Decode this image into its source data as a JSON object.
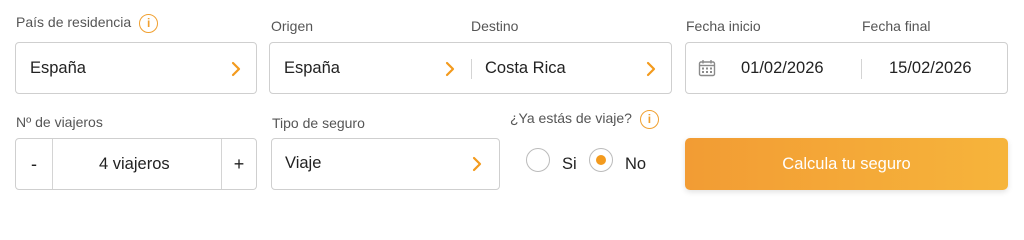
{
  "residence": {
    "label": "País de residencia",
    "value": "España"
  },
  "route": {
    "origin_label": "Origen",
    "origin_value": "España",
    "destination_label": "Destino",
    "destination_value": "Costa Rica"
  },
  "dates": {
    "start_label": "Fecha inicio",
    "start_value": "01/02/2026",
    "end_label": "Fecha final",
    "end_value": "15/02/2026"
  },
  "travelers": {
    "label": "Nº de viajeros",
    "value": "4 viajeros",
    "minus": "-",
    "plus": "+"
  },
  "insurance_type": {
    "label": "Tipo de seguro",
    "value": "Viaje"
  },
  "already_traveling": {
    "label": "¿Ya estás de viaje?",
    "yes_label": "Si",
    "no_label": "No",
    "selected": "No"
  },
  "info_icon_glyph": "i",
  "cta": {
    "label": "Calcula tu seguro"
  },
  "colors": {
    "accent": "#f39a1d",
    "border": "#cfcfcf",
    "cta_start": "#f29c34",
    "cta_end": "#f6b43b"
  }
}
